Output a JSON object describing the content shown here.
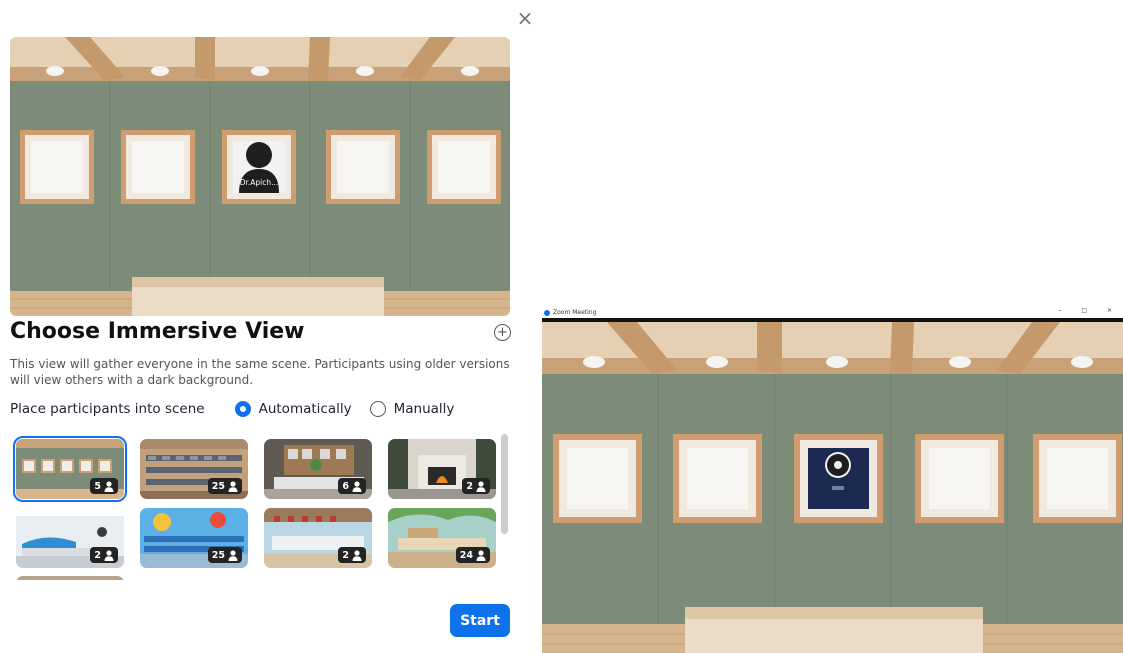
{
  "dialog": {
    "close_glyph": "×",
    "title": "Choose Immersive View",
    "description": "This view will gather everyone in the same scene. Participants using older versions will view others with a dark background.",
    "place_label": "Place participants into scene",
    "options": [
      {
        "label": "Automatically",
        "checked": true
      },
      {
        "label": "Manually",
        "checked": false
      }
    ],
    "participant_nameplate": "Dr.Apich...",
    "start_label": "Start",
    "add_glyph": "+"
  },
  "scenes": [
    {
      "name": "gallery",
      "count": "5",
      "selected": true
    },
    {
      "name": "auditorium",
      "count": "25"
    },
    {
      "name": "office",
      "count": "6"
    },
    {
      "name": "fireplace",
      "count": "2"
    },
    {
      "name": "bright-office",
      "count": "2"
    },
    {
      "name": "classroom",
      "count": "25"
    },
    {
      "name": "cafe",
      "count": "2"
    },
    {
      "name": "lounge",
      "count": "24"
    }
  ],
  "meeting_window": {
    "title": "Zoom Meeting",
    "controls": "– □ ×"
  },
  "colors": {
    "accent": "#0e72ed",
    "wall": "#7d8c78",
    "wood_beam": "#c9a27a",
    "frame_wood": "#cf9d6f",
    "floor": "#d6b48c"
  }
}
